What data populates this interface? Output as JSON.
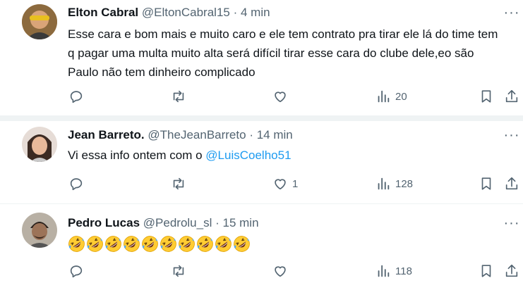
{
  "tweets": [
    {
      "name": "Elton Cabral",
      "handle": "@EltonCabral15",
      "sep": "·",
      "time": "4 min",
      "more": "···",
      "text": "Esse cara e bom mais e muito caro e ele tem contrato pra tirar ele lá do time tem q pagar uma multa muito alta será difícil tirar esse cara do clube dele,eo são Paulo não tem dinheiro complicado",
      "likes": "",
      "views": "20"
    },
    {
      "name": "Jean Barreto.",
      "handle": "@TheJeanBarreto",
      "sep": "·",
      "time": "14 min",
      "more": "···",
      "text": "Vi essa info ontem com o ",
      "mention": "@LuisCoelho51",
      "likes": "1",
      "views": "128"
    },
    {
      "name": "Pedro Lucas",
      "handle": "@Pedrolu_sl",
      "sep": "·",
      "time": "15 min",
      "more": "···",
      "emoji_count": 10,
      "emoji_icon": "rolling-on-the-floor-laughing-emoji",
      "likes": "",
      "views": "118"
    }
  ],
  "colors": {
    "text": "#0f1419",
    "muted": "#536471",
    "link": "#1d9bf0",
    "divider": "#eff3f4"
  }
}
